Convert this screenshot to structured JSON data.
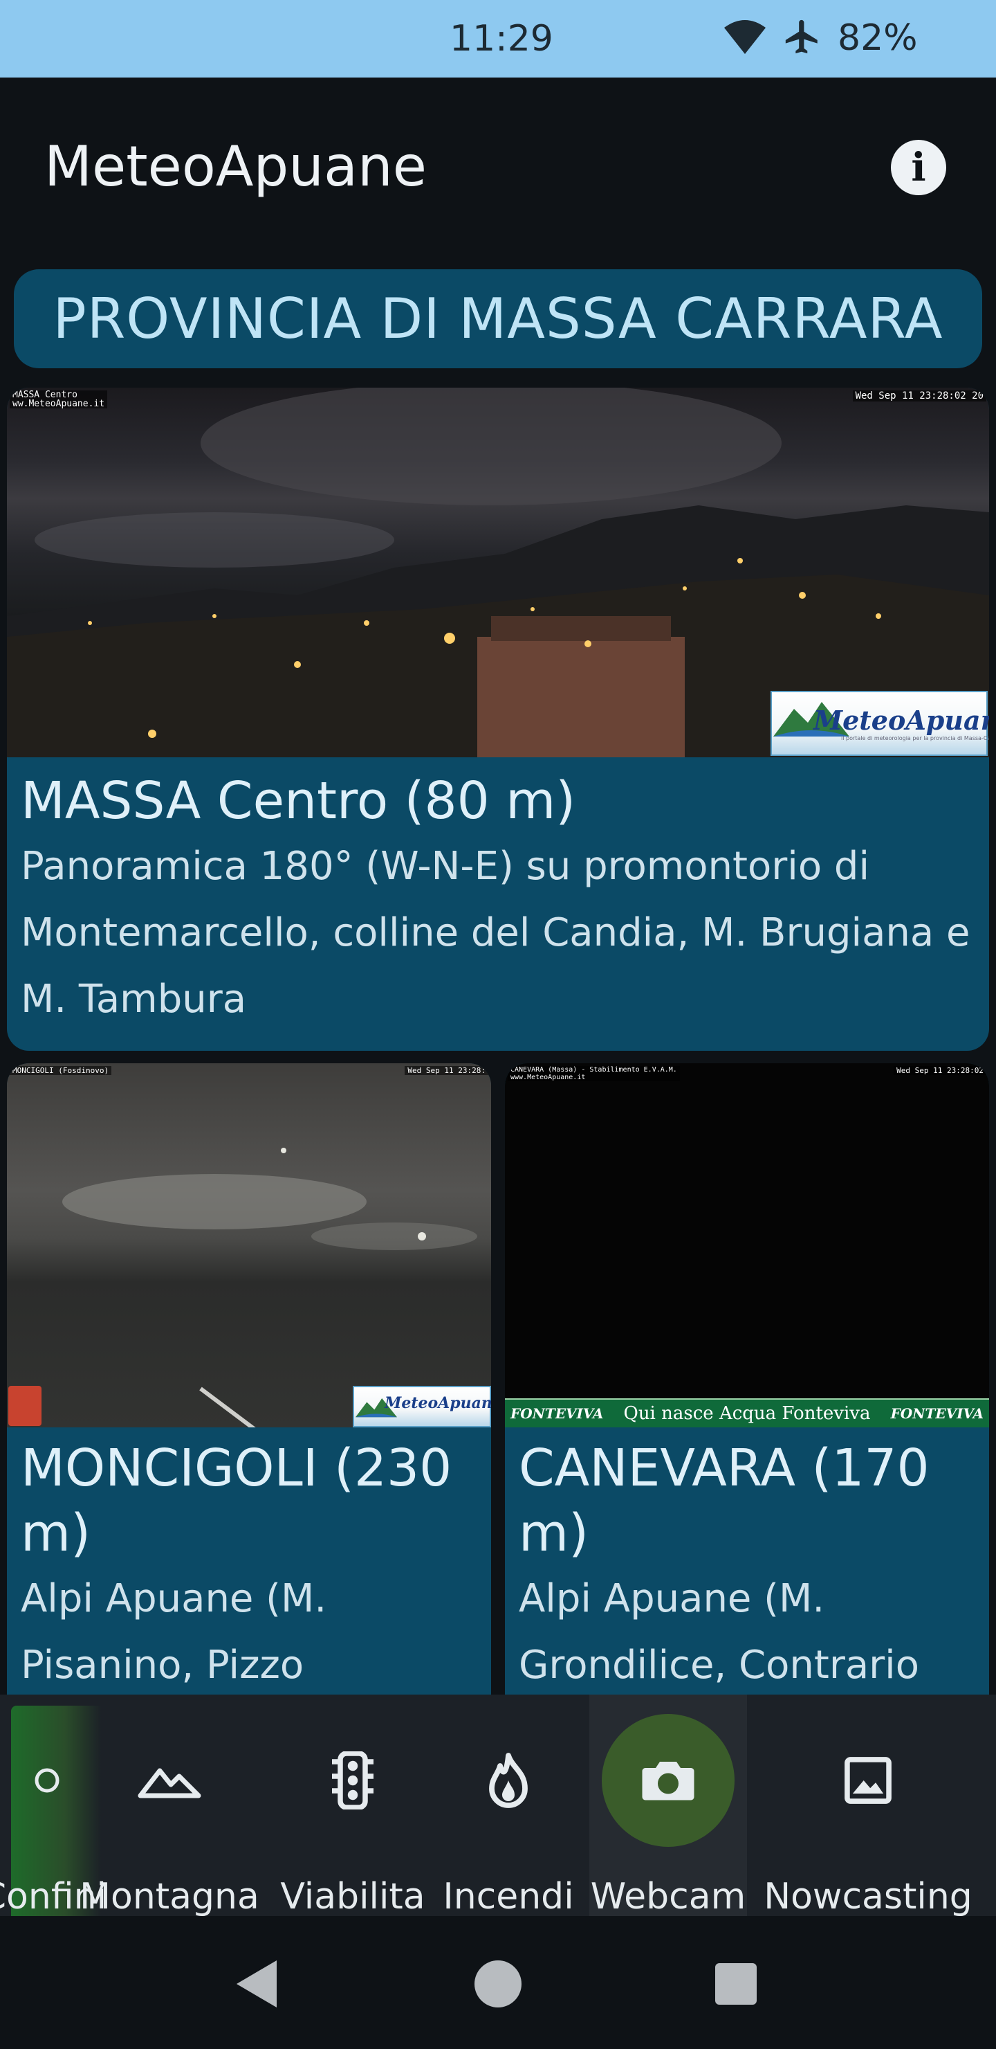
{
  "status_bar": {
    "time": "11:29",
    "battery": "82%",
    "icons": [
      "wifi-icon",
      "airplane-icon"
    ]
  },
  "app": {
    "title": "MeteoApuane",
    "info_icon": "info-icon"
  },
  "section_header": "PROVINCIA DI MASSA CARRARA",
  "webcams": [
    {
      "title": "MASSA Centro (80 m)",
      "description": "Panoramica 180° (W-N-E) su promontorio di Montemarcello, colline del Candia, M. Brugiana e M. Tambura",
      "overlay_left": "MASSA Centro",
      "overlay_left2": "ww.MeteoApuane.it",
      "overlay_right": "Wed Sep 11 23:28:02 20",
      "logo": "MeteoApuane",
      "logo_sub": "il portale di meteorologia per la provincia di Massa-Carrara"
    },
    {
      "title": "MONCIGOLI (230 m)",
      "description": "Alpi Apuane (M. Pisanino, Pizzo",
      "overlay_left": "MONCIGOLI (Fosdinovo)",
      "overlay_right": "Wed Sep 11 23:28:",
      "logo": "MeteoApuane"
    },
    {
      "title": "CANEVARA (170 m)",
      "description": "Alpi Apuane (M. Grondilice, Contrario",
      "overlay_left": "CANEVARA (Massa) - Stabilimento E.V.A.M.",
      "overlay_left2": "www.MeteoApuane.it",
      "overlay_right": "Wed Sep 11 23:28:02",
      "banner": "Qui nasce Acqua Fonteviva",
      "banner_brand": "FONTEVIVA"
    }
  ],
  "bottom_nav": {
    "items": [
      {
        "label": "Confini",
        "icon": "border-icon",
        "selected": false
      },
      {
        "label": "Montagna",
        "icon": "mountain-icon",
        "selected": false
      },
      {
        "label": "Viabilita",
        "icon": "traffic-light-icon",
        "selected": false
      },
      {
        "label": "Incendi",
        "icon": "fire-icon",
        "selected": false
      },
      {
        "label": "Webcam",
        "icon": "camera-icon",
        "selected": true
      },
      {
        "label": "Nowcasting",
        "icon": "image-icon",
        "selected": false
      }
    ]
  },
  "system_nav": [
    "back-icon",
    "home-icon",
    "recents-icon"
  ],
  "colors": {
    "status_bar": "#8ec9f0",
    "background": "#0e1216",
    "card": "#0b4a66",
    "nav_selected": "#3a5c2a"
  }
}
